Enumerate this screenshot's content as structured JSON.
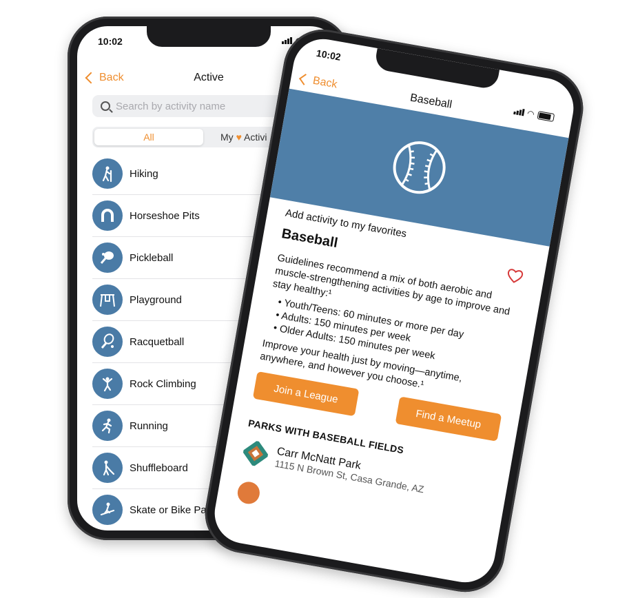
{
  "phone1": {
    "status_time": "10:02",
    "back_label": "Back",
    "title": "Active",
    "search_placeholder": "Search by activity name",
    "segment_all": "All",
    "segment_my_prefix": "My",
    "segment_my_suffix": "Activi",
    "activities": [
      {
        "label": "Hiking",
        "icon": "hiking-icon"
      },
      {
        "label": "Horseshoe Pits",
        "icon": "horseshoe-icon"
      },
      {
        "label": "Pickleball",
        "icon": "pickleball-icon"
      },
      {
        "label": "Playground",
        "icon": "playground-icon"
      },
      {
        "label": "Racquetball",
        "icon": "racquetball-icon"
      },
      {
        "label": "Rock Climbing",
        "icon": "rock-climbing-icon"
      },
      {
        "label": "Running",
        "icon": "running-icon"
      },
      {
        "label": "Shuffleboard",
        "icon": "shuffleboard-icon"
      },
      {
        "label": "Skate or Bike Par",
        "icon": "skate-icon"
      }
    ]
  },
  "phone2": {
    "status_time": "10:02",
    "back_label": "Back",
    "title": "Baseball",
    "favorite_line": "Add activity to my favorites",
    "activity_name": "Baseball",
    "intro": "Guidelines recommend a mix of both aerobic and muscle-strengthening activities by age to improve and stay healthy:¹",
    "bullets": [
      "Youth/Teens: 60 minutes or more per day",
      "Adults: 150 minutes per week",
      "Older Adults: 150 minutes per week"
    ],
    "closing": "Improve your health just by moving—anytime, anywhere, and however you choose.¹",
    "join_button": "Join a League",
    "meetup_button": "Find a Meetup",
    "parks_heading": "PARKS WITH BASEBALL FIELDS",
    "park_name": "Carr McNatt Park",
    "park_address": "1115 N Brown St, Casa Grande, AZ"
  },
  "colors": {
    "accent": "#ef8e2f",
    "icon_circle": "#4a7ba6",
    "hero": "#4f7fa8"
  }
}
